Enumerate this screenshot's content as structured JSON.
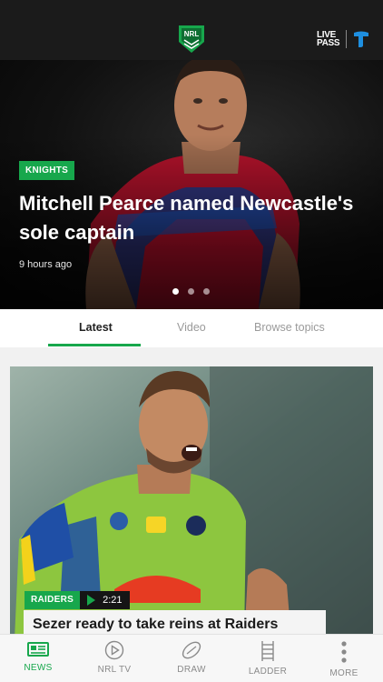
{
  "header": {
    "livepass_line1": "LIVE",
    "livepass_line2": "PASS",
    "logo_icon": "nrl-logo",
    "partner_icon": "telstra-icon"
  },
  "hero": {
    "tag": "KNIGHTS",
    "title": "Mitchell Pearce named Newcastle's sole captain",
    "time": "9 hours ago",
    "slides": 3,
    "active_slide": 1
  },
  "tabs": [
    {
      "label": "Latest",
      "active": true
    },
    {
      "label": "Video",
      "active": false
    },
    {
      "label": "Browse topics",
      "active": false
    }
  ],
  "card": {
    "tag": "RAIDERS",
    "duration": "2:21",
    "title": "Sezer ready to take reins at Raiders"
  },
  "nav": [
    {
      "label": "NEWS",
      "icon": "news-icon",
      "active": true
    },
    {
      "label": "NRL TV",
      "icon": "play-circle-icon",
      "active": false
    },
    {
      "label": "DRAW",
      "icon": "football-icon",
      "active": false
    },
    {
      "label": "LADDER",
      "icon": "ladder-icon",
      "active": false
    },
    {
      "label": "MORE",
      "icon": "more-vertical-icon",
      "active": false
    }
  ],
  "colors": {
    "accent": "#17a74c",
    "header_bg": "#1b1b1b",
    "knights_red": "#c8102e",
    "knights_blue": "#1a3d8f",
    "raiders_lime": "#8dc63f"
  }
}
